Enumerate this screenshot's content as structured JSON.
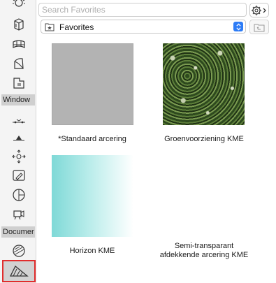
{
  "toolbox": {
    "sections": [
      "Window",
      "Documer"
    ]
  },
  "search": {
    "placeholder": "Search Favorites"
  },
  "folder_select": {
    "value": "Favorites"
  },
  "favorites": [
    {
      "name": "*Standaard arcering",
      "swatch": "gray-fill"
    },
    {
      "name": "Groenvoorziening KME",
      "swatch": "green-hedge-texture"
    },
    {
      "name": "Horizon KME",
      "swatch": "cyan-gradient"
    },
    {
      "name": "Semi-transparant\nafdekkende arcering KME",
      "swatch": "transparent"
    }
  ],
  "colors": {
    "accent": "#2d7cf6",
    "selection_outline": "#e12d2d",
    "gray_fill": "#b3b3b3",
    "gradient_start": "#7fd9d7"
  }
}
